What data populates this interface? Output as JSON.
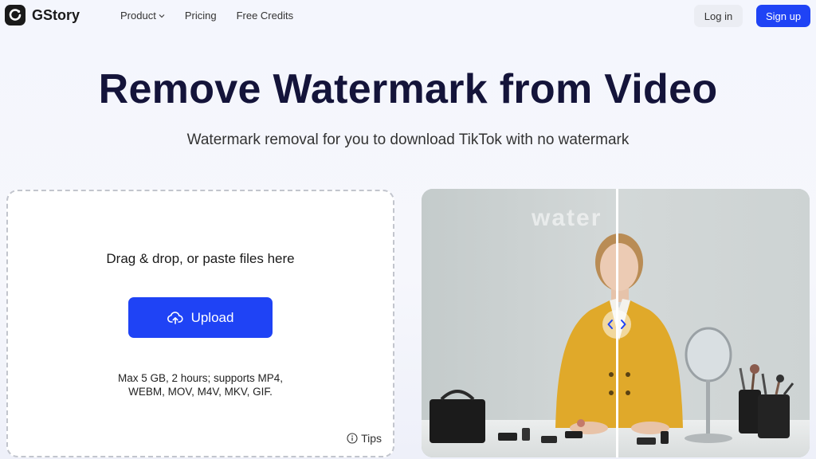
{
  "brand": {
    "name": "GStory"
  },
  "nav": {
    "links": [
      {
        "label": "Product",
        "has_dropdown": true
      },
      {
        "label": "Pricing"
      },
      {
        "label": "Free Credits"
      }
    ],
    "login_label": "Log in",
    "signup_label": "Sign up"
  },
  "hero": {
    "title": "Remove Watermark from Video",
    "subtitle": "Watermark removal for you to download TikTok with no watermark"
  },
  "upload": {
    "drop_text": "Drag & drop, or paste files here",
    "button_label": "Upload",
    "limits_line1": "Max 5 GB, 2 hours; supports MP4,",
    "limits_line2": "WEBM, MOV, M4V, MKV, GIF.",
    "tips_label": "Tips"
  },
  "preview": {
    "watermark_text": "water",
    "icons": [
      "chevron-left-icon",
      "chevron-right-icon"
    ]
  },
  "colors": {
    "accent": "#1f43f5",
    "title": "#14143a",
    "jacket": "#e0a92a"
  }
}
